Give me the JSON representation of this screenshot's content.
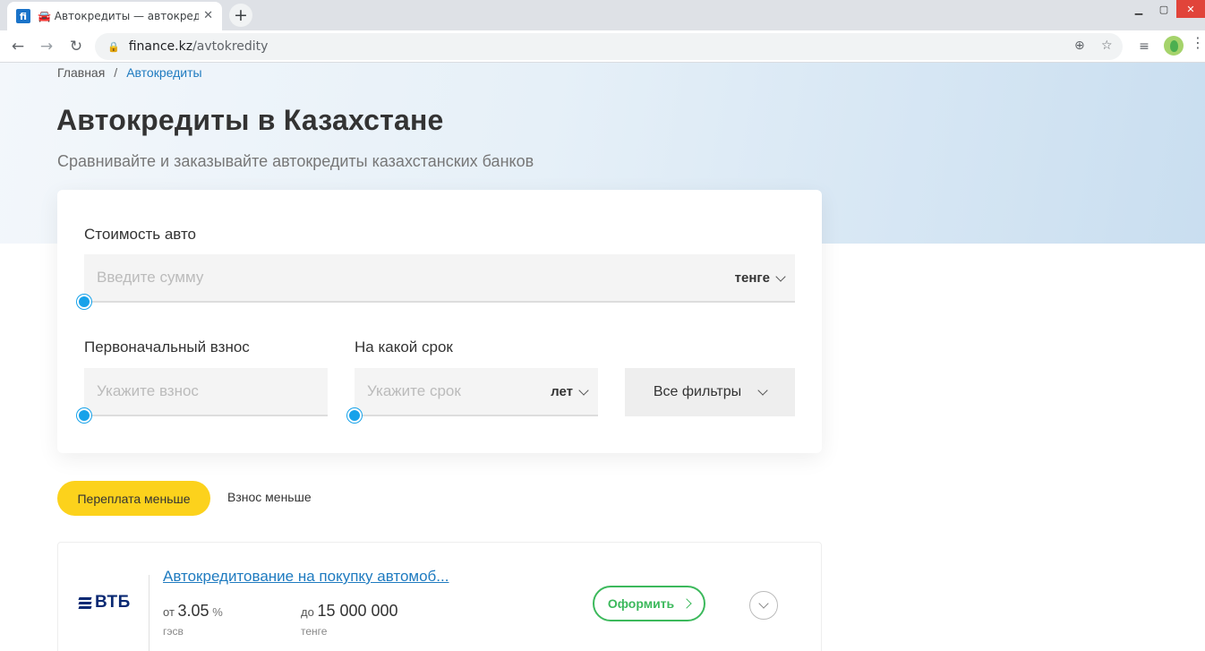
{
  "browser": {
    "tab_title": "🚘 Автокредиты — автокредиты",
    "tab_close": "✕",
    "favicon_text": "fi",
    "new_tab": "+",
    "url_domain": "finance.kz",
    "url_path": "/avtokredity",
    "icons": {
      "back": "back-arrow-icon",
      "forward": "forward-arrow-icon",
      "reload": "reload-icon",
      "lock": "lock-icon",
      "zoom": "zoom-icon",
      "bookmark": "star-icon",
      "media": "playlist-icon",
      "profile": "avatar-icon",
      "menu": "kebab-menu-icon"
    }
  },
  "breadcrumb": {
    "home": "Главная",
    "separator": "/",
    "current": "Автокредиты"
  },
  "header": {
    "title": "Автокредиты в Казахстане",
    "subtitle": "Сравнивайте и заказывайте автокредиты казахстанских банков"
  },
  "filters": {
    "car_price": {
      "label": "Стоимость авто",
      "placeholder": "Введите сумму",
      "unit": "тенге",
      "slider_value": 0
    },
    "down_payment": {
      "label": "Первоначальный взнос",
      "placeholder": "Укажите взнос",
      "slider_value": 0
    },
    "term": {
      "label": "На какой срок",
      "placeholder": "Укажите срок",
      "unit": "лет",
      "slider_value": 0
    },
    "all_filters": "Все фильтры"
  },
  "sort": {
    "active": "Переплата меньше",
    "other": "Взнос меньше"
  },
  "offers": [
    {
      "bank": "ВТБ",
      "title": "Автокредитование на покупку автомоб...",
      "rate_prefix": "от",
      "rate": "3.05",
      "rate_unit": "%",
      "rate_caption": "гэсв",
      "amount_prefix": "до",
      "amount": "15 000 000",
      "amount_caption": "тенге",
      "apply_label": "Оформить"
    }
  ],
  "colors": {
    "accent_blue": "#1f7bc0",
    "slider_blue": "#16a2ea",
    "sort_yellow": "#fcd21c",
    "apply_green": "#3cb95c",
    "bank_navy": "#0a2973"
  }
}
